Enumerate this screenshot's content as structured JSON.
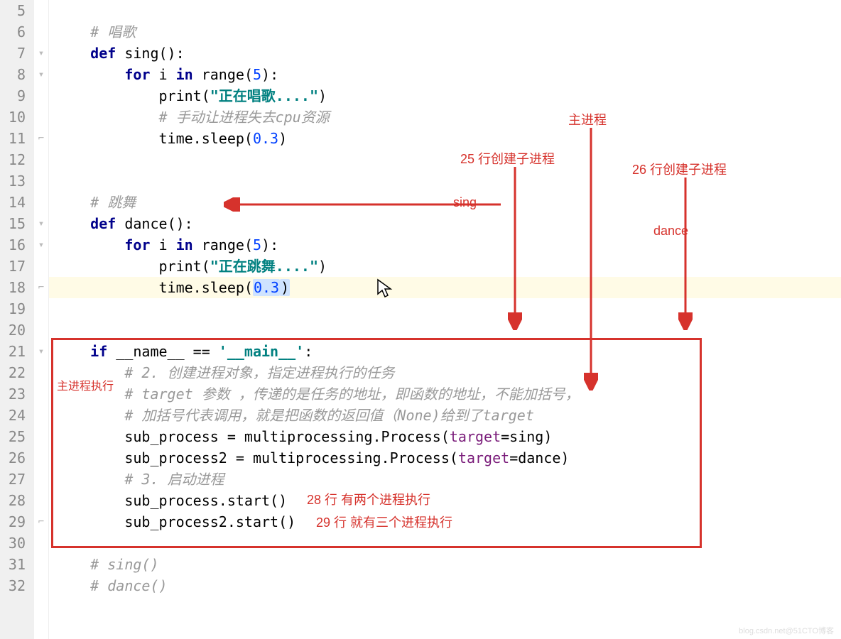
{
  "gutter": {
    "lines": [
      "5",
      "6",
      "7",
      "8",
      "9",
      "10",
      "11",
      "12",
      "13",
      "14",
      "15",
      "16",
      "17",
      "18",
      "19",
      "20",
      "21",
      "22",
      "23",
      "24",
      "25",
      "26",
      "27",
      "28",
      "29",
      "30",
      "31",
      "32"
    ]
  },
  "code": {
    "l5": "",
    "l6_comment": "# 唱歌",
    "l7_def": "def ",
    "l7_name": "sing",
    "l7_rest": "():",
    "l8_for": "for ",
    "l8_i": "i ",
    "l8_in": "in ",
    "l8_range": "range",
    "l8_paren": "(",
    "l8_num": "5",
    "l8_close": "):",
    "l9_print": "print(",
    "l9_str": "\"正在唱歌....\"",
    "l9_close": ")",
    "l10_comment": "# 手动让进程失去cpu资源",
    "l11_time": "time.sleep(",
    "l11_num": "0.3",
    "l11_close": ")",
    "l12": "",
    "l13": "",
    "l14_comment": "# 跳舞",
    "l15_def": "def ",
    "l15_name": "dance",
    "l15_rest": "():",
    "l16_for": "for ",
    "l16_i": "i ",
    "l16_in": "in ",
    "l16_range": "range",
    "l16_paren": "(",
    "l16_num": "5",
    "l16_close": "):",
    "l17_print": "print(",
    "l17_str": "\"正在跳舞....\"",
    "l17_close": ")",
    "l18_time": "time.sleep(",
    "l18_num": "0.3",
    "l18_close": ")",
    "l19": "",
    "l20": "",
    "l21_if": "if ",
    "l21_name1": "__name__ ",
    "l21_eq": "== ",
    "l21_str": "'__main__'",
    "l21_colon": ":",
    "l22_comment": "# 2. 创建进程对象，指定进程执行的任务",
    "l23_comment": "# target 参数 ，传递的是任务的地址，即函数的地址，不能加括号，",
    "l24_comment": "# 加括号代表调用，就是把函数的返回值（None)给到了target",
    "l25_a": "sub_process = multiprocessing.Process(",
    "l25_param": "target",
    "l25_b": "=sing)",
    "l26_a": "sub_process2 = multiprocessing.Process(",
    "l26_param": "target",
    "l26_b": "=dance)",
    "l27_comment": "# 3. 启动进程",
    "l28": "sub_process.start()",
    "l29": "sub_process2.start()",
    "l30": "",
    "l31_comment": "# sing()",
    "l32_comment": "# dance()"
  },
  "annotations": {
    "main_process": "主进程",
    "line25_creates": "25 行创建子进程",
    "line26_creates": "26 行创建子进程",
    "sing_label": "sing",
    "dance_label": "dance",
    "main_exec": "主进程执行",
    "line28_note": "28 行 有两个进程执行",
    "line29_note": "29 行 就有三个进程执行"
  },
  "watermark": "blog.csdn.net@51CTO博客"
}
